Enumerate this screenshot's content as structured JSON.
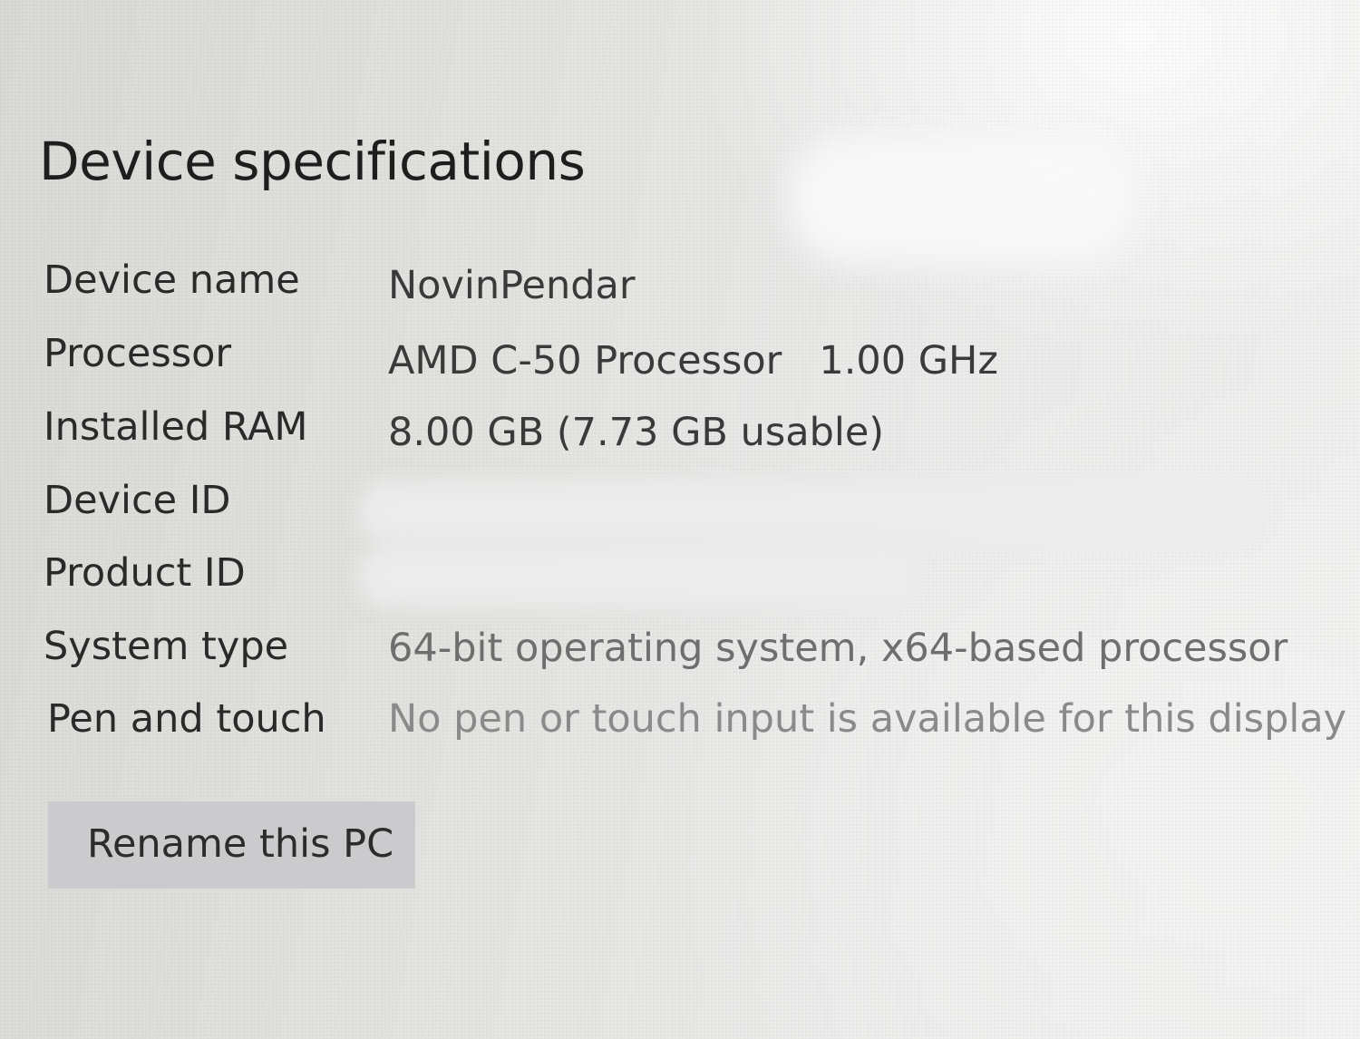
{
  "section": {
    "title": "Device specifications"
  },
  "specs": [
    {
      "label": "Device name",
      "value": "NovinPendar",
      "redacted": false
    },
    {
      "label": "Processor",
      "value": "AMD C-50 Processor   1.00 GHz",
      "redacted": false
    },
    {
      "label": "Installed RAM",
      "value": "8.00 GB (7.73 GB usable)",
      "redacted": false
    },
    {
      "label": "Device ID",
      "value": "",
      "redacted": true
    },
    {
      "label": "Product ID",
      "value": "",
      "redacted": true
    },
    {
      "label": "System type",
      "value": "64-bit operating system, x64-based processor",
      "redacted": false
    },
    {
      "label": "Pen and touch",
      "value": "No pen or touch input is available for this display",
      "redacted": false
    }
  ],
  "actions": {
    "rename_label": "Rename this PC"
  }
}
